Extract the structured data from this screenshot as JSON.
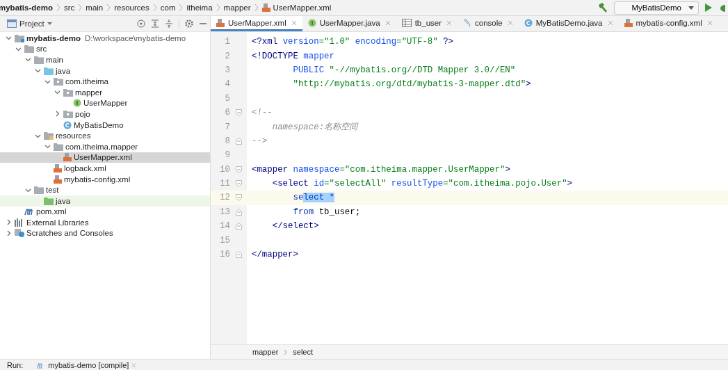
{
  "breadcrumb": [
    "mybatis-demo",
    "src",
    "main",
    "resources",
    "com",
    "itheima",
    "mapper",
    "UserMapper.xml"
  ],
  "run_config": {
    "label": "MyBatisDemo"
  },
  "project_panel": {
    "title": "Project"
  },
  "tree": [
    {
      "label": "mybatis-demo",
      "path": "D:\\workspace\\mybatis-demo",
      "kind": "module",
      "expanded": true,
      "selected": false,
      "children": [
        {
          "label": "src",
          "kind": "folder",
          "expanded": true,
          "selected": false,
          "children": [
            {
              "label": "main",
              "kind": "folder",
              "expanded": true,
              "selected": false,
              "children": [
                {
                  "label": "java",
                  "kind": "source",
                  "expanded": true,
                  "selected": false,
                  "children": [
                    {
                      "label": "com.itheima",
                      "kind": "package",
                      "expanded": true,
                      "selected": false,
                      "children": [
                        {
                          "label": "mapper",
                          "kind": "package",
                          "expanded": true,
                          "selected": false,
                          "children": [
                            {
                              "label": "UserMapper",
                              "kind": "interface",
                              "selected": false
                            }
                          ]
                        },
                        {
                          "label": "pojo",
                          "kind": "package",
                          "expanded": false,
                          "selected": false
                        },
                        {
                          "label": "MyBatisDemo",
                          "kind": "class",
                          "selected": false
                        }
                      ]
                    }
                  ]
                },
                {
                  "label": "resources",
                  "kind": "resources",
                  "expanded": true,
                  "selected": false,
                  "children": [
                    {
                      "label": "com.itheima.mapper",
                      "kind": "folder",
                      "expanded": true,
                      "selected": false,
                      "children": [
                        {
                          "label": "UserMapper.xml",
                          "kind": "xml",
                          "selected": true
                        }
                      ]
                    },
                    {
                      "label": "logback.xml",
                      "kind": "xml",
                      "selected": false
                    },
                    {
                      "label": "mybatis-config.xml",
                      "kind": "xml",
                      "selected": false
                    }
                  ]
                }
              ]
            },
            {
              "label": "test",
              "kind": "folder",
              "expanded": true,
              "selected": false,
              "children": [
                {
                  "label": "java",
                  "kind": "test-source",
                  "selected": false
                }
              ]
            }
          ]
        },
        {
          "label": "pom.xml",
          "kind": "maven",
          "selected": false
        }
      ]
    },
    {
      "label": "External Libraries",
      "kind": "libraries",
      "expanded": false,
      "selected": false
    },
    {
      "label": "Scratches and Consoles",
      "kind": "scratches",
      "expanded": false,
      "selected": false
    }
  ],
  "editor_tabs": [
    {
      "label": "UserMapper.xml",
      "kind": "xml",
      "selected": true
    },
    {
      "label": "UserMapper.java",
      "kind": "interface",
      "selected": false
    },
    {
      "label": "tb_user",
      "kind": "table",
      "selected": false
    },
    {
      "label": "console",
      "kind": "console",
      "selected": false
    },
    {
      "label": "MyBatisDemo.java",
      "kind": "class",
      "selected": false
    },
    {
      "label": "mybatis-config.xml",
      "kind": "xml",
      "selected": false
    }
  ],
  "code_lines": [
    {
      "number": "1",
      "current": false,
      "fold_start": false,
      "fold_end": false,
      "tokens": [
        {
          "text": "<?xml ",
          "kind": "tag"
        },
        {
          "text": "version",
          "kind": "attr"
        },
        {
          "text": "=\"1.0\" ",
          "kind": "value"
        },
        {
          "text": "encoding",
          "kind": "attr"
        },
        {
          "text": "=\"UTF-8\" ",
          "kind": "value"
        },
        {
          "text": "?>",
          "kind": "tag"
        }
      ]
    },
    {
      "number": "2",
      "current": false,
      "fold_start": false,
      "fold_end": false,
      "tokens": [
        {
          "text": "<!DOCTYPE ",
          "kind": "tag"
        },
        {
          "text": "mapper",
          "kind": "attr"
        }
      ]
    },
    {
      "number": "3",
      "current": false,
      "fold_start": false,
      "fold_end": false,
      "tokens": [
        {
          "text": "        PUBLIC ",
          "kind": "attr"
        },
        {
          "text": "\"-//mybatis.org//DTD Mapper 3.0//EN\"",
          "kind": "value"
        }
      ]
    },
    {
      "number": "4",
      "current": false,
      "fold_start": false,
      "fold_end": false,
      "tokens": [
        {
          "text": "        \"http://mybatis.org/dtd/mybatis-3-mapper.dtd\"",
          "kind": "value"
        },
        {
          "text": ">",
          "kind": "tag"
        }
      ]
    },
    {
      "number": "5",
      "current": false,
      "fold_start": false,
      "fold_end": false
    },
    {
      "number": "6",
      "current": false,
      "fold_start": true,
      "fold_end": false,
      "tokens": [
        {
          "text": "<!--",
          "kind": "comment"
        }
      ]
    },
    {
      "number": "7",
      "current": false,
      "fold_start": false,
      "fold_end": false,
      "tokens": [
        {
          "text": "    namespace:名称空间",
          "kind": "comment"
        }
      ]
    },
    {
      "number": "8",
      "current": false,
      "fold_start": false,
      "fold_end": true,
      "tokens": [
        {
          "text": "-->",
          "kind": "comment"
        }
      ]
    },
    {
      "number": "9",
      "current": false,
      "fold_start": false,
      "fold_end": false
    },
    {
      "number": "10",
      "current": false,
      "fold_start": true,
      "fold_end": false,
      "tokens": [
        {
          "text": "<mapper ",
          "kind": "tag"
        },
        {
          "text": "namespace",
          "kind": "attr"
        },
        {
          "text": "=\"com.itheima.mapper.UserMapper\"",
          "kind": "value"
        },
        {
          "text": ">",
          "kind": "tag"
        }
      ]
    },
    {
      "number": "11",
      "current": false,
      "fold_start": true,
      "fold_end": false,
      "tokens": [
        {
          "text": "    <select ",
          "kind": "tag"
        },
        {
          "text": "id",
          "kind": "attr"
        },
        {
          "text": "=\"selectAll\" ",
          "kind": "value"
        },
        {
          "text": "resultType",
          "kind": "attr"
        },
        {
          "text": "=\"com.itheima.pojo.User\"",
          "kind": "value"
        },
        {
          "text": ">",
          "kind": "tag"
        }
      ]
    },
    {
      "number": "12",
      "current": true,
      "fold_start": true,
      "fold_end": false,
      "tokens": [
        {
          "text": "        se",
          "kind": "sql"
        },
        {
          "text": "lect *",
          "kind": "selection"
        }
      ]
    },
    {
      "number": "13",
      "current": false,
      "fold_start": false,
      "fold_end": true,
      "tokens": [
        {
          "text": "        from ",
          "kind": "sql"
        },
        {
          "text": "tb_user;",
          "kind": "plain"
        }
      ]
    },
    {
      "number": "14",
      "current": false,
      "fold_start": false,
      "fold_end": true,
      "tokens": [
        {
          "text": "    </select>",
          "kind": "tag"
        }
      ]
    },
    {
      "number": "15",
      "current": false,
      "fold_start": false,
      "fold_end": false
    },
    {
      "number": "16",
      "current": false,
      "fold_start": false,
      "fold_end": true,
      "tokens": [
        {
          "text": "</mapper>",
          "kind": "tag"
        }
      ]
    }
  ],
  "structure_path": [
    "mapper",
    "select"
  ],
  "run_bar": {
    "label": "Run:",
    "tab": "mybatis-demo [compile]"
  }
}
